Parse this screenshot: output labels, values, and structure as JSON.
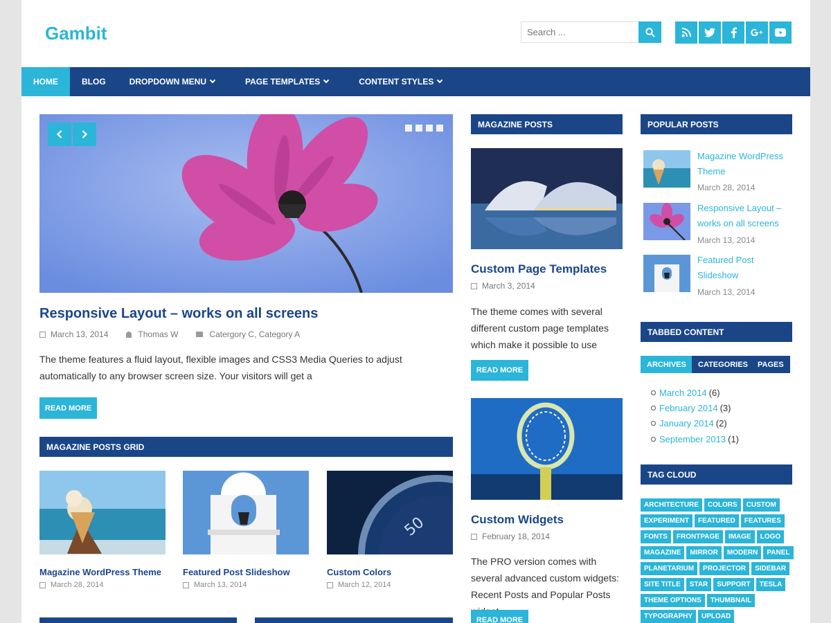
{
  "site": {
    "title": "Gambit"
  },
  "search": {
    "placeholder": "Search ..."
  },
  "social": {
    "rss": "rss-icon",
    "twitter": "twitter-icon",
    "facebook": "facebook-icon",
    "gplus": "googleplus-icon",
    "youtube": "youtube-icon"
  },
  "nav": [
    {
      "label": "HOME"
    },
    {
      "label": "BLOG"
    },
    {
      "label": "DROPDOWN MENU"
    },
    {
      "label": "PAGE TEMPLATES"
    },
    {
      "label": "CONTENT STYLES"
    }
  ],
  "featured": {
    "title": "Responsive Layout – works on all screens",
    "date": "March 13, 2014",
    "author": "Thomas W",
    "categories": "Catergory C, Category A",
    "excerpt": "The theme features a fluid layout, flexible images and CSS3 Media Queries to adjust automatically to any browser screen size. Your visitors will get a",
    "button": "READ MORE"
  },
  "grid": {
    "heading": "MAGAZINE POSTS GRID",
    "items": [
      {
        "title": "Magazine WordPress Theme",
        "date": "March 28, 2014"
      },
      {
        "title": "Featured Post Slideshow",
        "date": "March 13, 2014"
      },
      {
        "title": "Custom Colors",
        "date": "March 12, 2014"
      }
    ]
  },
  "magazine": {
    "heading": "MAGAZINE POSTS",
    "posts": [
      {
        "title": "Custom Page Templates",
        "date": "March 3, 2014",
        "excerpt": "The theme comes with several different custom page templates which make it possible to use",
        "button": "READ MORE"
      },
      {
        "title": "Custom Widgets",
        "date": "February 18, 2014",
        "excerpt": "The PRO version comes with several advanced custom widgets: Recent Posts and Popular Posts widget",
        "button": "READ MORE"
      }
    ]
  },
  "popular": {
    "heading": "POPULAR POSTS",
    "items": [
      {
        "title": "Magazine WordPress Theme",
        "date": "March 28, 2014"
      },
      {
        "title": "Responsive Layout – works on all screens",
        "date": "March 13, 2014"
      },
      {
        "title": "Featured Post Slideshow",
        "date": "March 13, 2014"
      }
    ]
  },
  "tabbed": {
    "heading": "TABBED CONTENT",
    "tabs": [
      "ARCHIVES",
      "CATEGORIES",
      "PAGES"
    ],
    "archives": [
      {
        "label": "March 2014",
        "count": "(6)"
      },
      {
        "label": "February 2014",
        "count": "(3)"
      },
      {
        "label": "January 2014",
        "count": "(2)"
      },
      {
        "label": "September 2013",
        "count": "(1)"
      }
    ]
  },
  "tagcloud": {
    "heading": "TAG CLOUD",
    "tags": [
      "ARCHITECTURE",
      "COLORS",
      "CUSTOM",
      "EXPERIMENT",
      "FEATURED",
      "FEATURES",
      "FONTS",
      "FRONTPAGE",
      "IMAGE",
      "LOGO",
      "MAGAZINE",
      "MIRROR",
      "MODERN",
      "PANEL",
      "PLANETARIUM",
      "PROJECTOR",
      "SIDEBAR",
      "SITE TITLE",
      "STAR",
      "SUPPORT",
      "TESLA",
      "THEME OPTIONS",
      "THUMBNAIL",
      "TYPOGRAPHY",
      "UPLOAD"
    ]
  },
  "colors": {
    "accent": "#2bb5d8",
    "navy": "#1a4688"
  }
}
